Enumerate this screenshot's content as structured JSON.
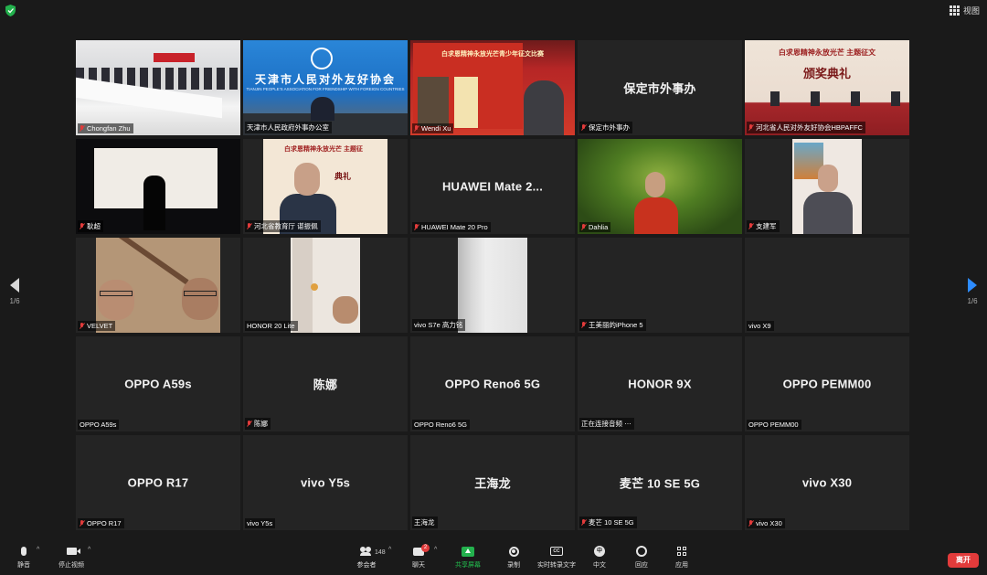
{
  "topbar": {
    "view_label": "视图"
  },
  "nav": {
    "left_page": "1/6",
    "right_page": "1/6"
  },
  "tiles": [
    {
      "name": "Chongfan Zhu",
      "muted": true
    },
    {
      "name": "天津市人民政府外事办公室",
      "muted": false,
      "banner_title": "天津市人民对外友好协会",
      "banner_subtitle": "TIANJIN PEOPLE'S ASSOCIATION FOR FRIENDSHIP WITH FOREIGN COUNTRIES"
    },
    {
      "name": "Wendi Xu",
      "muted": true,
      "poster_text": "白求恩精神永放光芒青少年征文比赛"
    },
    {
      "name": "保定市外事办",
      "muted": true,
      "center": "保定市外事办"
    },
    {
      "name": "河北省人民对外友好协会HBPAFFC",
      "muted": true,
      "active": true,
      "title1": "白求恩精神永放光芒 主题征文",
      "title2": "颁奖典礼"
    },
    {
      "name": "耿超",
      "muted": true
    },
    {
      "name": "河北省教育厅 谌振佩",
      "muted": true,
      "title1": "白求恩精神永放光芒 主题征",
      "title2": "典礼"
    },
    {
      "name": "HUAWEI Mate 20 Pro",
      "muted": true,
      "center": "HUAWEI Mate 2..."
    },
    {
      "name": "Dahlia",
      "muted": true
    },
    {
      "name": "支建军",
      "muted": true
    },
    {
      "name": "VELVET",
      "muted": true
    },
    {
      "name": "HONOR 20 Lite",
      "muted": false
    },
    {
      "name": "vivo S7e 高力铭",
      "muted": false
    },
    {
      "name": "王美丽的iPhone 5",
      "muted": true
    },
    {
      "name": "vivo X9",
      "muted": false
    },
    {
      "name": "OPPO A59s",
      "muted": false,
      "center": "OPPO A59s"
    },
    {
      "name": "陈娜",
      "muted": true,
      "center": "陈娜"
    },
    {
      "name": "OPPO Reno6 5G",
      "muted": false,
      "center": "OPPO Reno6 5G"
    },
    {
      "name": "正在连接音频 ⋯",
      "muted": false,
      "center": "HONOR 9X"
    },
    {
      "name": "OPPO PEMM00",
      "muted": false,
      "center": "OPPO PEMM00"
    },
    {
      "name": "OPPO R17",
      "muted": true,
      "center": "OPPO R17"
    },
    {
      "name": "vivo Y5s",
      "muted": false,
      "center": "vivo Y5s"
    },
    {
      "name": "王海龙",
      "muted": false,
      "center": "王海龙"
    },
    {
      "name": "麦芒 10 SE 5G",
      "muted": true,
      "center": "麦芒 10 SE 5G"
    },
    {
      "name": "vivo X30",
      "muted": true,
      "center": "vivo X30"
    }
  ],
  "toolbar": {
    "mute": "静音",
    "stop_video": "停止视频",
    "participants": "参会者",
    "participants_count": "148",
    "chat": "聊天",
    "chat_badge": "2",
    "share": "共享屏幕",
    "record": "录制",
    "captions": "实时转录文字",
    "language": "中文",
    "language_icon": "中",
    "reactions": "回应",
    "apps": "应用",
    "captions_icon": "CC",
    "leave": "离开"
  },
  "colors": {
    "accent_green": "#23b14d",
    "accent_red": "#e23b3b",
    "active_border": "#c4d87a",
    "nav_blue": "#2d8cff"
  }
}
